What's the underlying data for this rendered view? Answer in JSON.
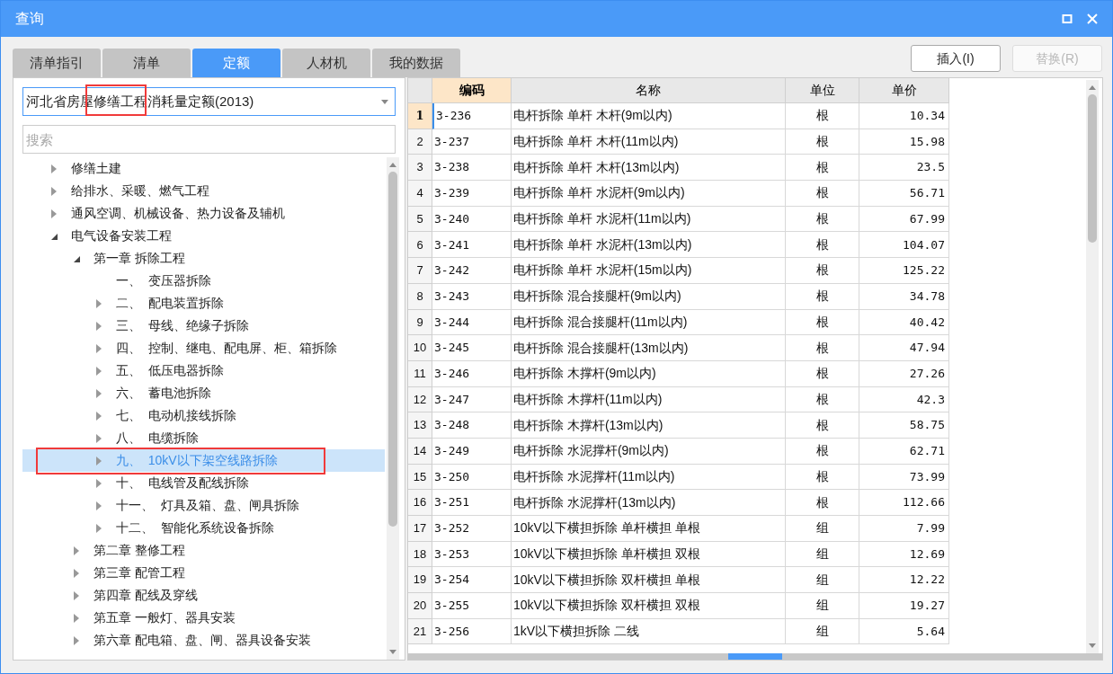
{
  "window": {
    "title": "查询"
  },
  "tabs": [
    {
      "label": "清单指引",
      "selected": false
    },
    {
      "label": "清单",
      "selected": false
    },
    {
      "label": "定额",
      "selected": true
    },
    {
      "label": "人材机",
      "selected": false
    },
    {
      "label": "我的数据",
      "selected": false
    }
  ],
  "buttons": [
    {
      "label": "插入(I)",
      "disabled": false
    },
    {
      "label": "替换(R)",
      "disabled": true
    }
  ],
  "library_select": {
    "value": "河北省房屋修缮工程消耗量定额(2013)"
  },
  "search": {
    "placeholder": "搜索"
  },
  "tree": [
    {
      "label": "修缮土建",
      "kind": "folder",
      "expanded": false,
      "selected": false
    },
    {
      "label": "给排水、采暖、燃气工程",
      "kind": "folder",
      "expanded": false,
      "selected": false
    },
    {
      "label": "通风空调、机械设备、热力设备及辅机",
      "kind": "folder",
      "expanded": false,
      "selected": false
    },
    {
      "label": "电气设备安装工程",
      "kind": "folder",
      "expanded": true,
      "selected": false,
      "children": [
        {
          "label": "第一章 拆除工程",
          "kind": "folder",
          "expanded": true,
          "selected": false,
          "children": [
            {
              "label": "一、  变压器拆除",
              "kind": "leaf",
              "selected": false
            },
            {
              "label": "二、  配电装置拆除",
              "kind": "folder",
              "expanded": false,
              "selected": false
            },
            {
              "label": "三、  母线、绝缘子拆除",
              "kind": "folder",
              "expanded": false,
              "selected": false
            },
            {
              "label": "四、  控制、继电、配电屏、柜、箱拆除",
              "kind": "folder",
              "expanded": false,
              "selected": false
            },
            {
              "label": "五、  低压电器拆除",
              "kind": "folder",
              "expanded": false,
              "selected": false
            },
            {
              "label": "六、  蓄电池拆除",
              "kind": "folder",
              "expanded": false,
              "selected": false
            },
            {
              "label": "七、  电动机接线拆除",
              "kind": "folder",
              "expanded": false,
              "selected": false
            },
            {
              "label": "八、  电缆拆除",
              "kind": "folder",
              "expanded": false,
              "selected": false
            },
            {
              "label": "九、  10kV以下架空线路拆除",
              "kind": "folder",
              "expanded": false,
              "selected": true
            },
            {
              "label": "十、  电线管及配线拆除",
              "kind": "folder",
              "expanded": false,
              "selected": false
            },
            {
              "label": "十一、  灯具及箱、盘、闸具拆除",
              "kind": "folder",
              "expanded": false,
              "selected": false
            },
            {
              "label": "十二、  智能化系统设备拆除",
              "kind": "folder",
              "expanded": false,
              "selected": false
            }
          ]
        },
        {
          "label": "第二章 整修工程",
          "kind": "folder",
          "expanded": false,
          "selected": false
        },
        {
          "label": "第三章 配管工程",
          "kind": "folder",
          "expanded": false,
          "selected": false
        },
        {
          "label": "第四章 配线及穿线",
          "kind": "folder",
          "expanded": false,
          "selected": false
        },
        {
          "label": "第五章 一般灯、器具安装",
          "kind": "folder",
          "expanded": false,
          "selected": false
        },
        {
          "label": "第六章 配电箱、盘、闸、器具设备安装",
          "kind": "folder",
          "expanded": false,
          "selected": false
        }
      ]
    }
  ],
  "table": {
    "columns": [
      {
        "label": "编码",
        "selected": true
      },
      {
        "label": "名称",
        "selected": false
      },
      {
        "label": "单位",
        "selected": false
      },
      {
        "label": "单价",
        "selected": false
      }
    ],
    "rows": [
      {
        "number": "1",
        "selected": true,
        "cells": [
          "3-236",
          "电杆拆除 单杆 木杆(9m以内)",
          "根",
          "10.34"
        ]
      },
      {
        "number": "2",
        "selected": false,
        "cells": [
          "3-237",
          "电杆拆除 单杆 木杆(11m以内)",
          "根",
          "15.98"
        ]
      },
      {
        "number": "3",
        "selected": false,
        "cells": [
          "3-238",
          "电杆拆除 单杆 木杆(13m以内)",
          "根",
          "23.5"
        ]
      },
      {
        "number": "4",
        "selected": false,
        "cells": [
          "3-239",
          "电杆拆除 单杆 水泥杆(9m以内)",
          "根",
          "56.71"
        ]
      },
      {
        "number": "5",
        "selected": false,
        "cells": [
          "3-240",
          "电杆拆除 单杆 水泥杆(11m以内)",
          "根",
          "67.99"
        ]
      },
      {
        "number": "6",
        "selected": false,
        "cells": [
          "3-241",
          "电杆拆除 单杆 水泥杆(13m以内)",
          "根",
          "104.07"
        ]
      },
      {
        "number": "7",
        "selected": false,
        "cells": [
          "3-242",
          "电杆拆除 单杆 水泥杆(15m以内)",
          "根",
          "125.22"
        ]
      },
      {
        "number": "8",
        "selected": false,
        "cells": [
          "3-243",
          "电杆拆除 混合接腿杆(9m以内)",
          "根",
          "34.78"
        ]
      },
      {
        "number": "9",
        "selected": false,
        "cells": [
          "3-244",
          "电杆拆除 混合接腿杆(11m以内)",
          "根",
          "40.42"
        ]
      },
      {
        "number": "10",
        "selected": false,
        "cells": [
          "3-245",
          "电杆拆除 混合接腿杆(13m以内)",
          "根",
          "47.94"
        ]
      },
      {
        "number": "11",
        "selected": false,
        "cells": [
          "3-246",
          "电杆拆除 木撑杆(9m以内)",
          "根",
          "27.26"
        ]
      },
      {
        "number": "12",
        "selected": false,
        "cells": [
          "3-247",
          "电杆拆除 木撑杆(11m以内)",
          "根",
          "42.3"
        ]
      },
      {
        "number": "13",
        "selected": false,
        "cells": [
          "3-248",
          "电杆拆除 木撑杆(13m以内)",
          "根",
          "58.75"
        ]
      },
      {
        "number": "14",
        "selected": false,
        "cells": [
          "3-249",
          "电杆拆除 水泥撑杆(9m以内)",
          "根",
          "62.71"
        ]
      },
      {
        "number": "15",
        "selected": false,
        "cells": [
          "3-250",
          "电杆拆除 水泥撑杆(11m以内)",
          "根",
          "73.99"
        ]
      },
      {
        "number": "16",
        "selected": false,
        "cells": [
          "3-251",
          "电杆拆除 水泥撑杆(13m以内)",
          "根",
          "112.66"
        ]
      },
      {
        "number": "17",
        "selected": false,
        "cells": [
          "3-252",
          "10kV以下横担拆除 单杆横担 单根",
          "组",
          "7.99"
        ]
      },
      {
        "number": "18",
        "selected": false,
        "cells": [
          "3-253",
          "10kV以下横担拆除 单杆横担 双根",
          "组",
          "12.69"
        ]
      },
      {
        "number": "19",
        "selected": false,
        "cells": [
          "3-254",
          "10kV以下横担拆除 双杆横担 单根",
          "组",
          "12.22"
        ]
      },
      {
        "number": "20",
        "selected": false,
        "cells": [
          "3-255",
          "10kV以下横担拆除 双杆横担 双根",
          "组",
          "19.27"
        ]
      },
      {
        "number": "21",
        "selected": false,
        "cells": [
          "3-256",
          "1kV以下横担拆除 二线",
          "组",
          "5.64"
        ]
      }
    ]
  }
}
